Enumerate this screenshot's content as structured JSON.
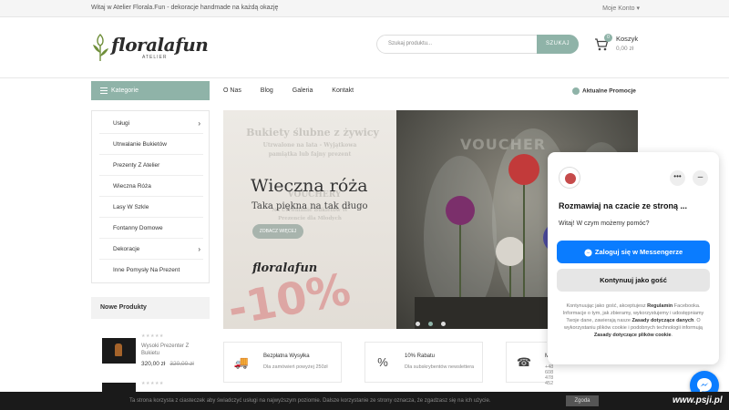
{
  "topbar": {
    "welcome": "Witaj w Atelier Florala.Fun - dekoracje handmade na każdą okazję",
    "account": "Moje Konto ▾"
  },
  "logo": {
    "name": "floralafun",
    "sub": "ATELIER"
  },
  "search": {
    "placeholder": "Szukaj produktu...",
    "button": "SZUKAJ"
  },
  "cart": {
    "count": "0",
    "label": "Koszyk",
    "total": "0,00 zł"
  },
  "categories": {
    "button": "Kategorie",
    "items": [
      {
        "label": "Usługi",
        "arrow": "›"
      },
      {
        "label": "Utrwalanie Bukietów",
        "arrow": ""
      },
      {
        "label": "Prezenty Z Atelier",
        "arrow": ""
      },
      {
        "label": "Wieczna Róża",
        "arrow": ""
      },
      {
        "label": "Lasy W Szkle",
        "arrow": ""
      },
      {
        "label": "Fontanny Domowe",
        "arrow": ""
      },
      {
        "label": "Dekoracje",
        "arrow": "›"
      },
      {
        "label": "Inne Pomysły Na Prezent",
        "arrow": ""
      }
    ]
  },
  "nav": {
    "items": [
      "O Nas",
      "Blog",
      "Galeria",
      "Kontakt"
    ],
    "promo": "Aktualne Promocje"
  },
  "new_products": {
    "heading": "Nowe Produkty",
    "items": [
      {
        "stars": "★★★★★",
        "name": "Wysoki Prezenter Z Bukietu",
        "price": "320,00 zł",
        "old_price": "320,00 zł"
      }
    ],
    "second_stars": "★★★★★"
  },
  "hero": {
    "fade1": "Bukiety ślubne z żywicy",
    "fade2": "Utrwalone na lata - Wyjątkowa pamiątka lub fajny prezent",
    "fade3": "VOUCHERY",
    "fade4": "Na Utrwalanie Bukietów W Prezencie dla Młodych",
    "title": "Wieczna róża",
    "tagline": "Taka piękna na tak długo",
    "cta": "ZOBACZ WIĘCEJ",
    "percent": "-10%",
    "logo": "floralafun",
    "voucher": "VOUCHER",
    "slides": 3,
    "active_slide": 2
  },
  "features": [
    {
      "title": "Bezpłatna Wysyłka",
      "sub": "Dla zamówień powyżej 250zł"
    },
    {
      "title": "10% Rabatu",
      "sub": "Dla subskrybentów newslettera"
    },
    {
      "title": "M",
      "sub": "+48 608 478 452"
    }
  ],
  "chat": {
    "title": "Rozmawiaj na czacie ze stroną ...",
    "greeting": "Witaj! W czym możemy pomóc?",
    "login_button": "Zaloguj się w Messengerze",
    "guest_button": "Kontynuuj jako gość",
    "legal_1": "Kontynuując jako gość, akceptujesz ",
    "legal_link1": "Regulamin",
    "legal_2": " Facebooka. Informacje o tym, jak zbieramy, wykorzystujemy i udostępniamy Twoje dane, zawierają nasze ",
    "legal_link2": "Zasady dotyczące danych",
    "legal_3": ". O wykorzystaniu plików cookie i podobnych technologii informują ",
    "legal_link3": "Zasady dotyczące plików cookie",
    "legal_4": "."
  },
  "cookie": {
    "text": "Ta strona korzysta z ciasteczek aby świadczyć usługi na najwyższym poziomie. Dalsze korzystanie ze strony oznacza, że zgadzasz się na ich użycie.",
    "button": "Zgoda"
  },
  "watermark": "www.psji.pl",
  "colors": {
    "accent": "#8fb3a8",
    "messenger": "#0a7cff"
  }
}
